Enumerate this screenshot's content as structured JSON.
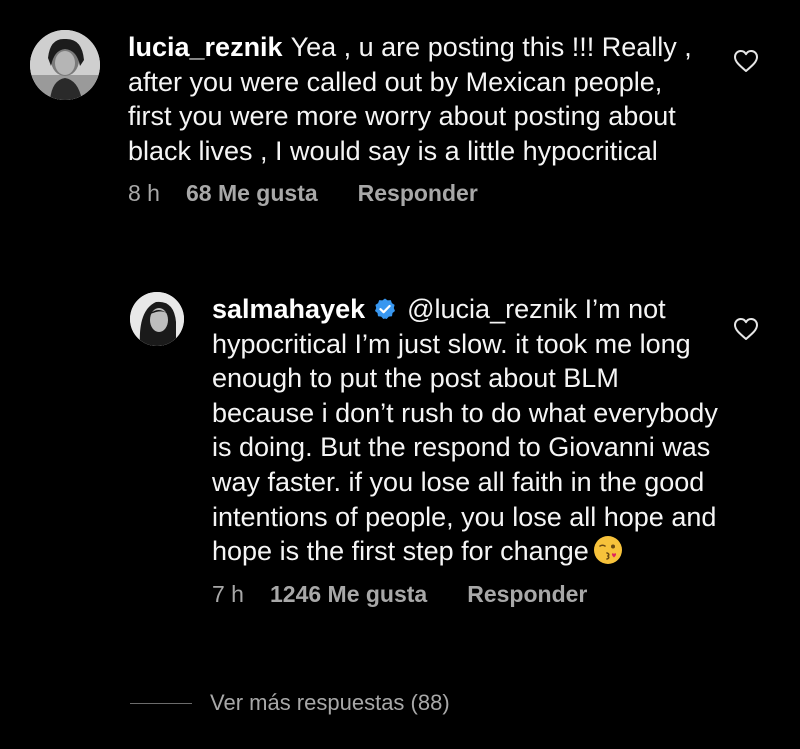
{
  "comments": [
    {
      "username": "lucia_reznik",
      "text": "Yea , u are posting this !!! Really , after you were called out by Mexican people, first you were more worry about posting about black lives ,  I would say is a little hypocritical",
      "time": "8 h",
      "likes": "68 Me gusta",
      "reply_label": "Responder",
      "like_icon": "heart-outline-icon"
    },
    {
      "username": "salmahayek",
      "verified": true,
      "mention": "@lucia_reznik",
      "text": "I’m not hypocritical I’m just slow. it took me long enough to put the post about BLM because i don’t rush to do what everybody is doing. But the respond to Giovanni was way faster.  if you lose all faith in the good intentions of people, you lose all hope and hope is the first step for change",
      "emoji": "😘",
      "time": "7 h",
      "likes": "1246 Me gusta",
      "reply_label": "Responder",
      "like_icon": "heart-outline-icon"
    }
  ],
  "view_more_replies": "Ver más respuestas (88)",
  "colors": {
    "background": "#000000",
    "text": "#f5f5f5",
    "secondary": "#a8a8a8",
    "verified": "#3897f0"
  }
}
